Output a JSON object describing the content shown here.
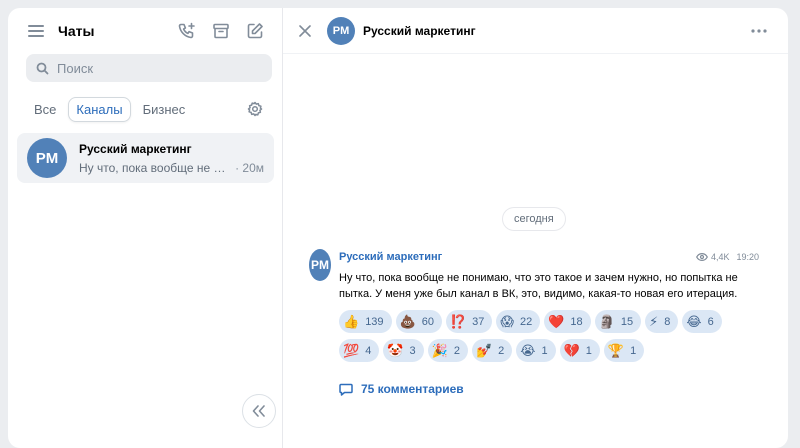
{
  "sidebar": {
    "title": "Чаты",
    "search_placeholder": "Поиск",
    "tabs": [
      {
        "label": "Все",
        "active": false
      },
      {
        "label": "Каналы",
        "active": true
      },
      {
        "label": "Бизнес",
        "active": false
      }
    ],
    "chats": [
      {
        "avatar": "PM",
        "name": "Русский маркетинг",
        "preview": "Ну что, пока вообще не пони...",
        "ago": "· 20м"
      }
    ]
  },
  "channel": {
    "avatar": "PM",
    "title": "Русский маркетинг"
  },
  "date_divider": "сегодня",
  "message": {
    "avatar": "PM",
    "author": "Русский маркетинг",
    "views": "4,4K",
    "time": "19:20",
    "text": "Ну что, пока вообще не понимаю, что это такое и зачем нужно, но попытка не пытка. У меня уже был канал в ВК, это, видимо, какая-то новая его итерация.",
    "reactions": [
      {
        "emoji": "👍",
        "count": "139"
      },
      {
        "emoji": "💩",
        "count": "60"
      },
      {
        "emoji": "⁉️",
        "count": "37"
      },
      {
        "emoji": "😱",
        "count": "22"
      },
      {
        "emoji": "❤️",
        "count": "18"
      },
      {
        "emoji": "🗿",
        "count": "15"
      },
      {
        "emoji": "⚡",
        "count": "8"
      },
      {
        "emoji": "😂",
        "count": "6"
      },
      {
        "emoji": "💯",
        "count": "4"
      },
      {
        "emoji": "🤡",
        "count": "3"
      },
      {
        "emoji": "🎉",
        "count": "2"
      },
      {
        "emoji": "💅",
        "count": "2"
      },
      {
        "emoji": "😭",
        "count": "1"
      },
      {
        "emoji": "💔",
        "count": "1"
      },
      {
        "emoji": "🏆",
        "count": "1"
      }
    ],
    "comments_label": "75 комментариев"
  },
  "colors": {
    "accent": "#2d6dbb",
    "avatar_bg": "#5181b8",
    "reaction_bg": "#dbe7f5"
  }
}
